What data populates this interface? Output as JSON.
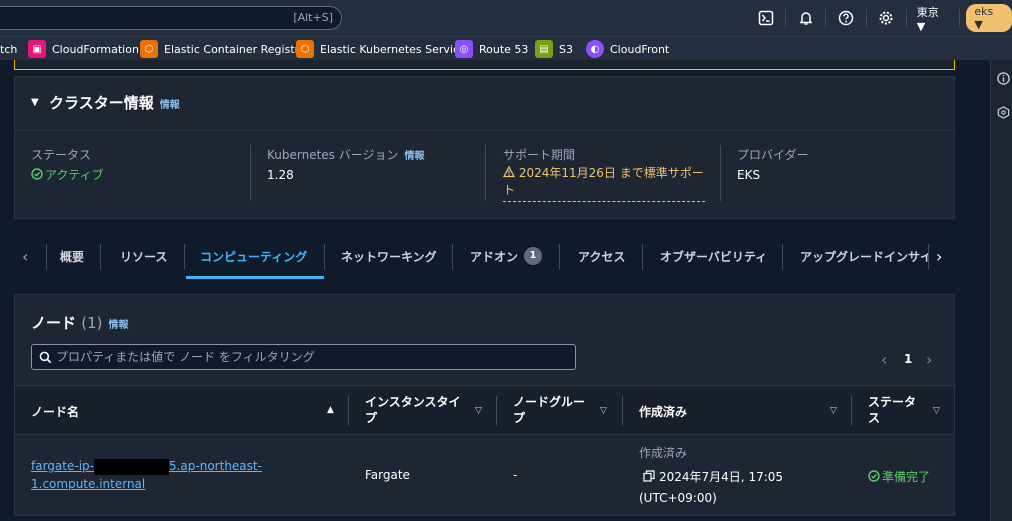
{
  "topbar": {
    "search_shortcut": "[Alt+S]",
    "region": "東京 ▼",
    "account": "eks ▼"
  },
  "favorites": [
    {
      "label": "tch",
      "color": ""
    },
    {
      "label": "CloudFormation",
      "color": "#e7157b"
    },
    {
      "label": "Elastic Container Registry",
      "color": "#ed7100"
    },
    {
      "label": "Elastic Kubernetes Service",
      "color": "#ed7100"
    },
    {
      "label": "Route 53",
      "color": "#8c4fff"
    },
    {
      "label": "S3",
      "color": "#7aa116"
    },
    {
      "label": "CloudFront",
      "color": "#8c4fff"
    }
  ],
  "cluster_info": {
    "title": "クラスター情報",
    "info": "情報",
    "status_label": "ステータス",
    "status_value": "アクティブ",
    "k8s_label": "Kubernetes バージョン",
    "k8s_info": "情報",
    "k8s_value": "1.28",
    "support_label": "サポート期間",
    "support_value_line1": "2024年11月26日 まで標準サポー",
    "support_value_line2": "ト",
    "provider_label": "プロバイダー",
    "provider_value": "EKS"
  },
  "tabs": [
    "概要",
    "リソース",
    "コンピューティング",
    "ネットワーキング",
    "アドオン",
    "アクセス",
    "オブザーバビリティ",
    "アップグレードインサイ"
  ],
  "addon_count": "1",
  "nodes": {
    "title": "ノード",
    "count": "(1)",
    "info": "情報",
    "filter_placeholder": "プロパティまたは値で ノード をフィルタリング",
    "page": "1",
    "columns": {
      "name": "ノード名",
      "instance_type_1": "インスタンスタイ",
      "instance_type_2": "プ",
      "node_group_1": "ノードグルー",
      "node_group_2": "プ",
      "created": "作成済み",
      "status_1": "ステータ",
      "status_2": "ス"
    },
    "rows": [
      {
        "name_1a": "fargate-ip-",
        "name_1b": "5.ap-northeast-",
        "name_2": "1.compute.internal",
        "instance_type": "Fargate",
        "node_group": "-",
        "created_label": "作成済み",
        "created_value": "2024年7月4日, 17:05",
        "created_tz": "(UTC+09:00)",
        "status": "準備完了"
      }
    ]
  }
}
